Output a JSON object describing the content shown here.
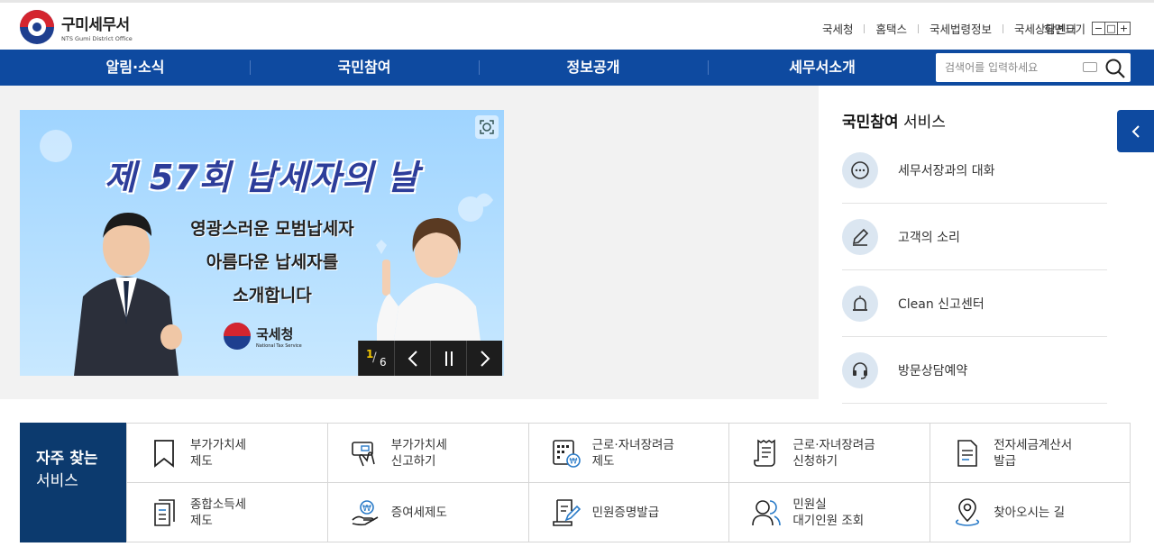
{
  "site": {
    "logo_title": "구미세무서",
    "logo_subtitle": "NTS Gumi District Office"
  },
  "utility_links": [
    "국세청",
    "홈택스",
    "국세법령정보",
    "국세상담센터"
  ],
  "zoom": {
    "label": "화면크기",
    "buttons": [
      "−",
      "□",
      "+"
    ]
  },
  "gnb": {
    "items": [
      "알림·소식",
      "국민참여",
      "정보공개",
      "세무서소개"
    ]
  },
  "search": {
    "placeholder": "검색어를 입력하세요"
  },
  "banner": {
    "title": "제 57회 납세자의 날",
    "subtitle_lines": [
      "영광스러운 모범납세자",
      "아름다운 납세자를",
      "소개합니다"
    ],
    "brand": "국세청",
    "brand_en": "National Tax Service",
    "current_slide": "1",
    "total_slides": "6"
  },
  "side": {
    "title_bold": "국민참여",
    "title_rest": " 서비스",
    "items": [
      {
        "label": "세무서장과의 대화",
        "icon": "chat-bubble-icon"
      },
      {
        "label": "고객의 소리",
        "icon": "pencil-icon"
      },
      {
        "label": "Clean 신고센터",
        "icon": "siren-icon"
      },
      {
        "label": "방문상담예약",
        "icon": "headset-icon"
      }
    ]
  },
  "favorites": {
    "heading_bold": "자주 찾는",
    "heading_light": "서비스",
    "items": [
      {
        "label": "부가가치세\n제도",
        "icon": "bookmark-icon"
      },
      {
        "label": "부가가치세\n신고하기",
        "icon": "touch-card-icon"
      },
      {
        "label": "근로·자녀장려금\n제도",
        "icon": "calculator-won-icon"
      },
      {
        "label": "근로·자녀장려금\n신청하기",
        "icon": "receipt-icon"
      },
      {
        "label": "전자세금계산서\n발급",
        "icon": "document-icon"
      },
      {
        "label": "종합소득세\n제도",
        "icon": "documents-icon"
      },
      {
        "label": "증여세제도",
        "icon": "hand-coin-icon"
      },
      {
        "label": "민원증명발급",
        "icon": "certificate-pen-icon"
      },
      {
        "label": "민원실\n대기인원 조회",
        "icon": "people-icon"
      },
      {
        "label": "찾아오시는 길",
        "icon": "location-pin-icon"
      }
    ]
  }
}
